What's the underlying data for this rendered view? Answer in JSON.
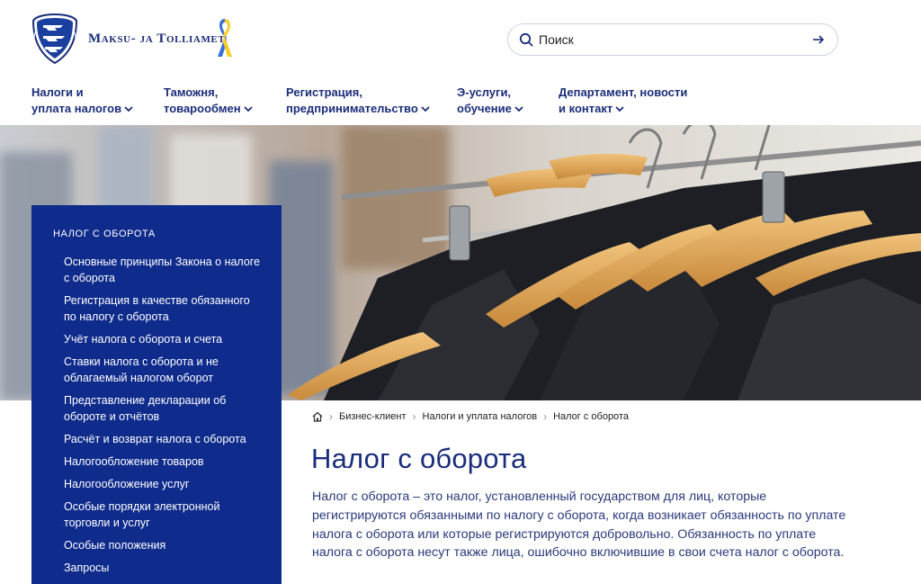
{
  "header": {
    "logo_text": "Maksu- ja Tolliamet",
    "search": {
      "placeholder": "Поиск"
    }
  },
  "nav": {
    "items": [
      {
        "line1": "Налоги и",
        "line2": "уплата налогов"
      },
      {
        "line1": "Таможня,",
        "line2": "товарообмен"
      },
      {
        "line1": "Регистрация,",
        "line2": "предпринимательство"
      },
      {
        "line1": "Э-услуги,",
        "line2": "обучение"
      },
      {
        "line1": "Департамент, новости",
        "line2": "и контакт"
      }
    ]
  },
  "sidebar": {
    "title": "НАЛОГ С ОБОРОТА",
    "items": [
      "Основные принципы Закона о налоге с оборота",
      "Регистрация в качестве обязанного по налогу с оборота",
      "Учёт налога с оборота и счета",
      "Ставки налога с оборота и не облагаемый налогом оборот",
      "Представление декларации об обороте и отчётов",
      "Расчёт и возврат налога с оборота",
      "Налогообложение товаров",
      "Налогообложение услуг",
      "Особые порядки электронной торговли и услуг",
      "Особые положения",
      "Запросы"
    ]
  },
  "breadcrumb": [
    "Бизнес-клиент",
    "Налоги и уплата налогов",
    "Налог с оборота"
  ],
  "main": {
    "title": "Налог с оборота",
    "lead": "Налог с оборота – это налог, установленный государством для лиц, которые регистрируются обязанными по налогу с оборота, когда возникает обязанность по уплате налога с оборота или которые регистрируются добровольно. Обязанность по уплате налога с оборота несут также лица, ошибочно включившие в свои счета налог с оборота."
  },
  "colors": {
    "brand_blue": "#1b2d7a",
    "sidebar_bg": "#0f2b8c",
    "ribbon_blue": "#3a6fd8",
    "ribbon_yellow": "#f3cf2a"
  },
  "icons": [
    "estonian-crest-icon",
    "ukraine-ribbon-icon",
    "search-icon",
    "arrow-right-icon",
    "chevron-down-icon",
    "home-icon"
  ]
}
